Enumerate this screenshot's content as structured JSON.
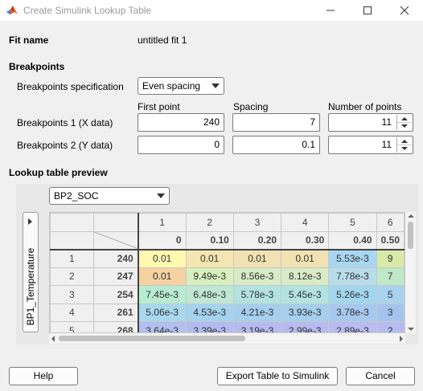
{
  "window": {
    "title": "Create Simulink Lookup Table",
    "app_icon": "matlab-icon",
    "minimize_icon": "minimize-icon",
    "maximize_icon": "maximize-icon",
    "close_icon": "close-icon"
  },
  "fit": {
    "label": "Fit name",
    "value": "untitled fit 1"
  },
  "breakpoints": {
    "section_label": "Breakpoints",
    "spec_label": "Breakpoints specification",
    "spec_value": "Even spacing",
    "col_headers": {
      "first_point": "First point",
      "spacing": "Spacing",
      "num_points": "Number of points"
    },
    "rows": [
      {
        "label": "Breakpoints 1 (X data)",
        "first_point": "240",
        "spacing": "7",
        "num_points": "11"
      },
      {
        "label": "Breakpoints 2 (Y data)",
        "first_point": "0",
        "spacing": "0.1",
        "num_points": "11"
      }
    ]
  },
  "preview": {
    "section_label": "Lookup table preview",
    "column_dropdown": "BP2_SOC",
    "row_tab_label": "BP1_Temperature",
    "col_indices": [
      "1",
      "2",
      "3",
      "4",
      "5",
      "6"
    ],
    "col_breakpoints": [
      "0",
      "0.10",
      "0.20",
      "0.30",
      "0.40",
      "0.50"
    ],
    "rows": [
      {
        "index": "1",
        "bp": "240",
        "cells": [
          "0.01",
          "0.01",
          "0.01",
          "0.01",
          "5.53e-3",
          "9"
        ]
      },
      {
        "index": "2",
        "bp": "247",
        "cells": [
          "0.01",
          "9.49e-3",
          "8.56e-3",
          "8.12e-3",
          "7.78e-3",
          "7"
        ]
      },
      {
        "index": "3",
        "bp": "254",
        "cells": [
          "7.45e-3",
          "6.48e-3",
          "5.78e-3",
          "5.45e-3",
          "5.26e-3",
          "5"
        ]
      },
      {
        "index": "4",
        "bp": "261",
        "cells": [
          "5.06e-3",
          "4.53e-3",
          "4.21e-3",
          "3.93e-3",
          "3.78e-3",
          "3"
        ]
      },
      {
        "index": "5",
        "bp": "268",
        "cells": [
          "3.64e-3",
          "3.39e-3",
          "3.19e-3",
          "2.99e-3",
          "2.89e-3",
          "2"
        ]
      }
    ],
    "cell_colors": [
      [
        "#fff9b0",
        "#f3e6b0",
        "#f0e2b3",
        "#f0e2b3",
        "#a9d6f0",
        "#d7eaa8"
      ],
      [
        "#f6d2a2",
        "#d8f0bd",
        "#d6ebc6",
        "#d6ebc6",
        "#b7ddea",
        "#bfe8c6"
      ],
      [
        "#b7ecd0",
        "#bfe7d4",
        "#b3e3e0",
        "#b3e3e0",
        "#a3d6ee",
        "#a9d2f0"
      ],
      [
        "#a7d8ef",
        "#a5d3ef",
        "#a4cfee",
        "#a4cfee",
        "#a5c9ef",
        "#a4c4ef"
      ],
      [
        "#b4bff0",
        "#b3bcf0",
        "#b7bbf0",
        "#b7bbf0",
        "#b9bcf0",
        "#b7bcf0"
      ]
    ]
  },
  "buttons": {
    "help": "Help",
    "export": "Export Table to Simulink",
    "cancel": "Cancel"
  }
}
